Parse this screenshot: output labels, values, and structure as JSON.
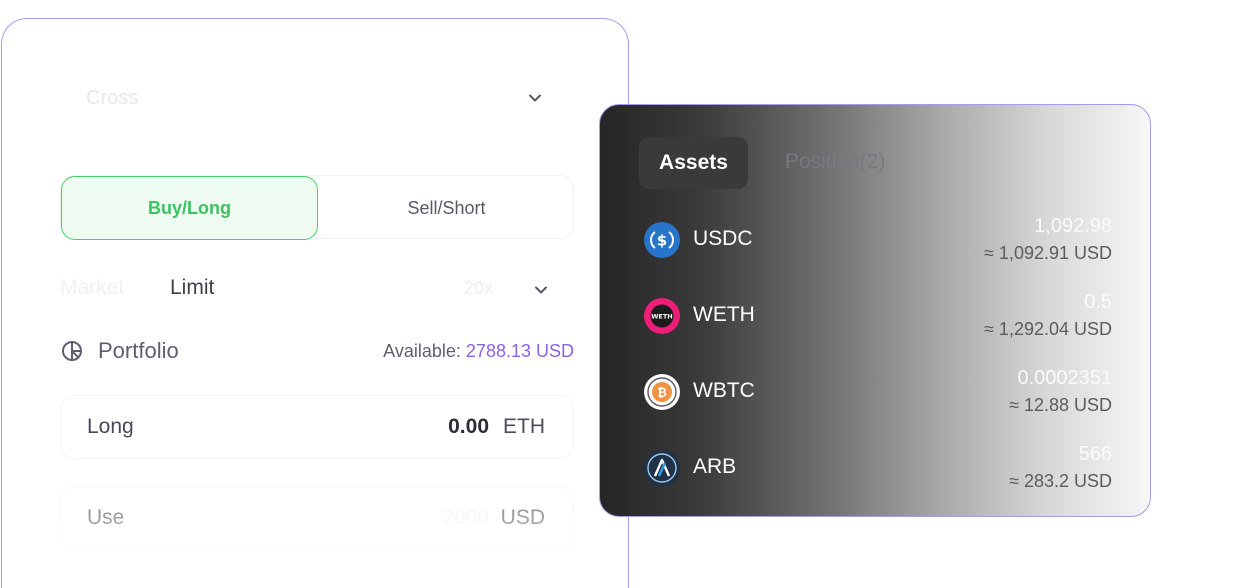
{
  "trade": {
    "margin_mode": "Cross",
    "side_buy": "Buy/Long",
    "side_sell": "Sell/Short",
    "order_market": "Market",
    "order_limit": "Limit",
    "leverage": "20x",
    "portfolio_label": "Portfolio",
    "available_label": "Available:",
    "available_value": "2788.13 USD",
    "long_label": "Long",
    "long_value": "0.00",
    "long_unit": "ETH",
    "use_label": "Use",
    "use_placeholder": "2000",
    "use_unit": "USD"
  },
  "assets_panel": {
    "tab_assets": "Assets",
    "tab_position": "Position(2)",
    "items": [
      {
        "symbol": "USDC",
        "balance": "1,092.98",
        "usd": "≈ 1,092.91 USD",
        "icon": "usdc-icon"
      },
      {
        "symbol": "WETH",
        "balance": "0.5",
        "usd": "≈ 1,292.04 USD",
        "icon": "weth-icon"
      },
      {
        "symbol": "WBTC",
        "balance": "0.0002351",
        "usd": "≈ 12.88 USD",
        "icon": "wbtc-icon"
      },
      {
        "symbol": "ARB",
        "balance": "566",
        "usd": "≈ 283.2 USD",
        "icon": "arb-icon"
      }
    ]
  },
  "colors": {
    "accent_purple": "#8a63e8",
    "buy_green": "#3cc262",
    "card_border": "#a99af2"
  }
}
